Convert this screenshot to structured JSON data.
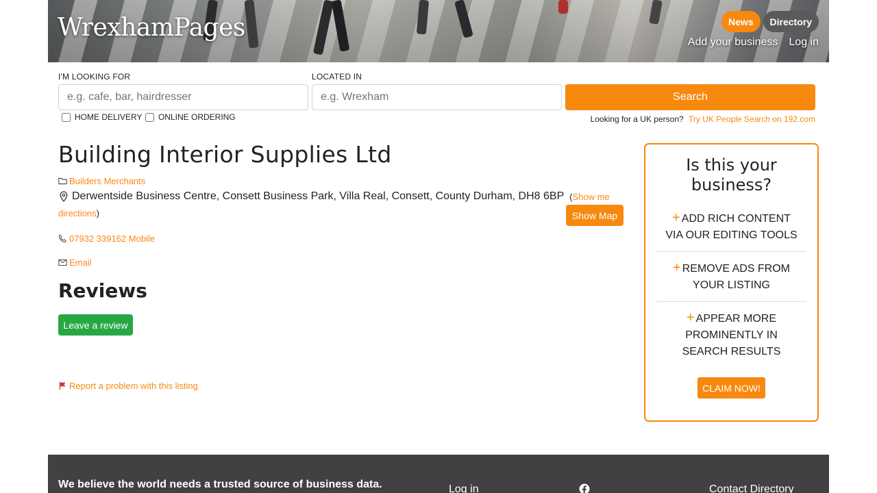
{
  "header": {
    "brand": "WrexhamPages",
    "pills": [
      "News",
      "Directory"
    ],
    "links": [
      "Add your business",
      "Log in"
    ]
  },
  "search": {
    "looking_label": "I'M LOOKING FOR",
    "looking_placeholder": "e.g. cafe, bar, hairdresser",
    "located_label": "LOCATED IN",
    "located_placeholder": "e.g. Wrexham",
    "button": "Search",
    "home_delivery": "HOME DELIVERY",
    "online_ordering": "ONLINE ORDERING",
    "uk_question": "Looking for a UK person?",
    "uk_link": "Try UK People Search on 192.com"
  },
  "listing": {
    "title": "Building Interior Supplies Ltd",
    "category": "Builders Merchants",
    "address": "Derwentside Business Centre, Consett Business Park, Villa Real, Consett, County Durham, DH8 6BP",
    "show_directions_1": "Show me",
    "show_directions_2": "directions",
    "show_map": "Show Map",
    "phone": "07932 339162 Mobile",
    "email": "Email"
  },
  "reviews": {
    "heading": "Reviews",
    "leave_button": "Leave a review",
    "report": "Report a problem with this listing"
  },
  "claim": {
    "heading_1": "Is this your",
    "heading_2": "business?",
    "benefit_1a": "ADD RICH CONTENT",
    "benefit_1b": "VIA OUR EDITING TOOLS",
    "benefit_2a": "REMOVE ADS FROM",
    "benefit_2b": "YOUR LISTING",
    "benefit_3a": "APPEAR MORE",
    "benefit_3b": "PROMINENTLY IN",
    "benefit_3c": "SEARCH RESULTS",
    "button": "CLAIM NOW!"
  },
  "footer": {
    "tagline": "We believe the world needs a trusted source of business data.",
    "login": "Log in",
    "contact": "Contact Directory"
  },
  "colors": {
    "accent": "#f7890e",
    "green": "#28a745",
    "footer": "#414141"
  }
}
